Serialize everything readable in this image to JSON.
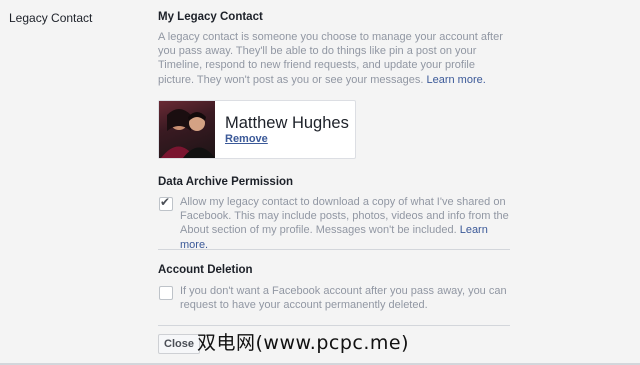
{
  "left_label": "Legacy Contact",
  "legacy": {
    "title": "My Legacy Contact",
    "description": "A legacy contact is someone you choose to manage your account after you pass away. They'll be able to do things like pin a post on your Timeline, respond to new friend requests, and update your profile picture. They won't post as you or see your messages.",
    "learn_more": "Learn more."
  },
  "contact": {
    "name": "Matthew Hughes",
    "remove_label": "Remove"
  },
  "archive": {
    "title": "Data Archive Permission",
    "text": "Allow my legacy contact to download a copy of what I've shared on Facebook. This may include posts, photos, videos and info from the About section of my profile. Messages won't be included.",
    "learn_more": "Learn more.",
    "checked": true,
    "check_glyph": "✔"
  },
  "deletion": {
    "title": "Account Deletion",
    "text": "If you don't want a Facebook account after you pass away, you can request to have your account permanently deleted.",
    "checked": false
  },
  "close_label": "Close",
  "watermark": "双电网(www.pcpc.me)",
  "colors": {
    "link": "#3b5998",
    "muted_text": "#9197a3",
    "background": "#f4f4f4"
  }
}
